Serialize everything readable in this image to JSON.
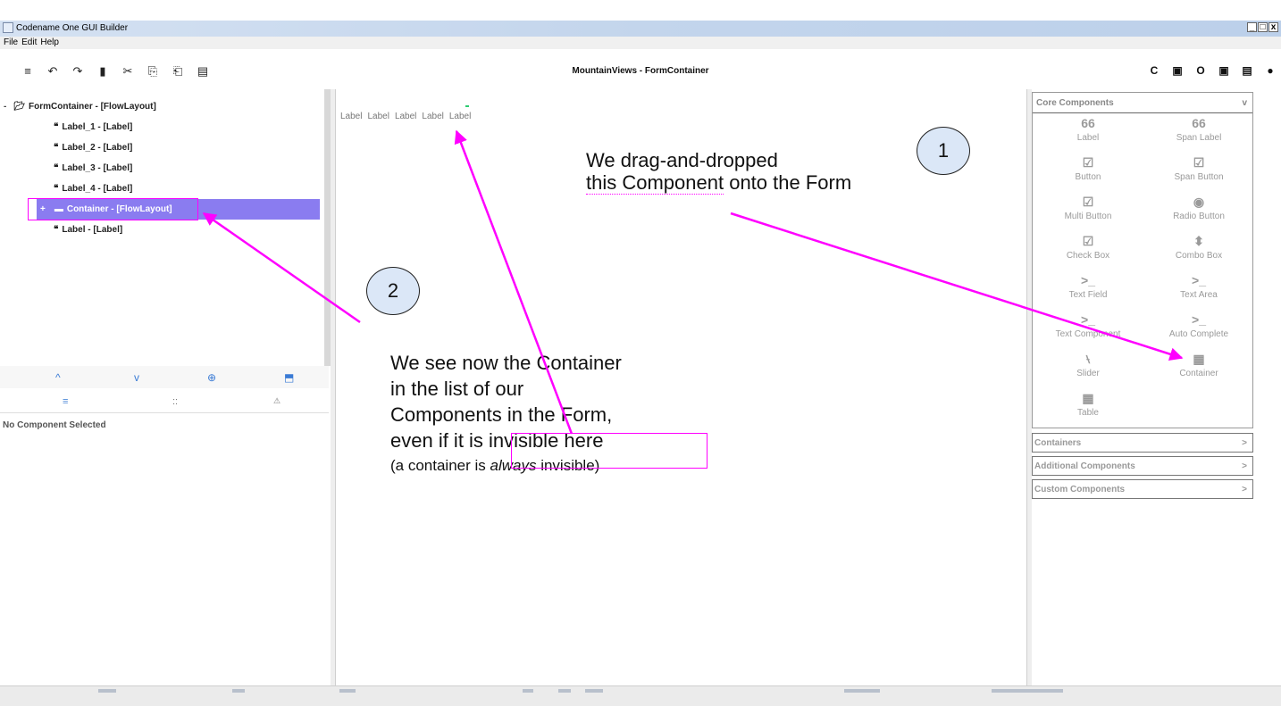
{
  "window": {
    "title": "Codename One GUI Builder",
    "controls": [
      "_",
      "□",
      "x"
    ]
  },
  "menubar": {
    "items": [
      "File",
      "Edit",
      "Help"
    ]
  },
  "toolbar": {
    "title": "MountainViews - FormContainer",
    "left_icons": [
      "menu-icon",
      "undo-icon",
      "redo-icon",
      "delete-icon",
      "cut-icon",
      "copy-icon",
      "paste-icon",
      "form-icon"
    ],
    "left_glyphs": [
      "≡",
      "↶",
      "↷",
      "▮",
      "✂",
      "⎘",
      "⎗",
      "▤"
    ],
    "right_icons": [
      "refresh-icon",
      "save-icon",
      "circle-icon",
      "preview-icon",
      "floppy-icon",
      "play-icon"
    ],
    "right_glyphs": [
      "C",
      "▣",
      "O",
      "▣",
      "▤",
      "●"
    ]
  },
  "tree": {
    "root_toggle": "-",
    "root_icon": "folder-open-icon",
    "root": "FormContainer - [FlowLayout]",
    "items": [
      {
        "label": "Label_1 - [Label]"
      },
      {
        "label": "Label_2 - [Label]"
      },
      {
        "label": "Label_3 - [Label]"
      },
      {
        "label": "Label_4 - [Label]"
      },
      {
        "label": "Container - [FlowLayout]",
        "toggle": "+"
      },
      {
        "label": "Label - [Label]"
      }
    ],
    "quote_glyph": "❝",
    "folder_glyph": "▬"
  },
  "nav": {
    "up": "^",
    "down": "v",
    "add": "⊕",
    "paste": "⬒"
  },
  "inspector_tabs": {
    "list": "≡",
    "grid": "::",
    "style": "⚠"
  },
  "inspector": {
    "empty": "No Component Selected"
  },
  "canvas": {
    "labels": [
      "Label",
      "Label",
      "Label",
      "Label",
      "Label"
    ]
  },
  "palette": {
    "header": "Core Components",
    "header_chevron": "v",
    "items": [
      {
        "name": "Label",
        "glyph": "66"
      },
      {
        "name": "Span Label",
        "glyph": "66"
      },
      {
        "name": "Button",
        "glyph": "☑"
      },
      {
        "name": "Span Button",
        "glyph": "☑"
      },
      {
        "name": "Multi Button",
        "glyph": "☑"
      },
      {
        "name": "Radio Button",
        "glyph": "◉"
      },
      {
        "name": "Check Box",
        "glyph": "☑"
      },
      {
        "name": "Combo Box",
        "glyph": "⬍"
      },
      {
        "name": "Text Field",
        "glyph": ">_"
      },
      {
        "name": "Text Area",
        "glyph": ">_"
      },
      {
        "name": "Text Component",
        "glyph": ">_"
      },
      {
        "name": "Auto Complete",
        "glyph": ">_"
      },
      {
        "name": "Slider",
        "glyph": "⧷"
      },
      {
        "name": "Container",
        "glyph": "▦"
      },
      {
        "name": "Table",
        "glyph": "▦"
      }
    ],
    "sections": [
      {
        "name": "Containers",
        "chevron": ">"
      },
      {
        "name": "Additional Components",
        "chevron": ">"
      },
      {
        "name": "Custom Components",
        "chevron": ">"
      }
    ]
  },
  "annotations": {
    "callout1": "1",
    "callout2": "2",
    "note1_line1": "We drag-and-dropped",
    "note1_line2a": "this Component",
    "note1_line2b": " onto the Form",
    "note2_lines": [
      "We see now the Container",
      "in the list of our",
      "Components in the Form,"
    ],
    "note2_line4a": "even if it is ",
    "note2_line4b": "invisible here",
    "note2_small_a": "(a container is ",
    "note2_small_b": "always",
    "note2_small_c": " invisible)",
    "accent": "#ff00ff"
  }
}
